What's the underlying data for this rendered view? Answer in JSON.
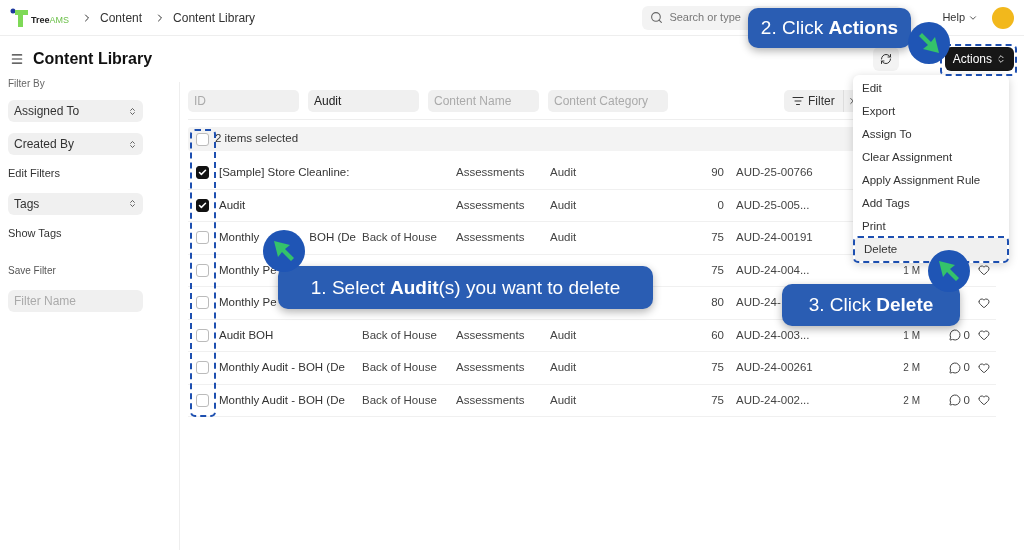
{
  "header": {
    "logo_start": "Tree",
    "logo_end": "AMS",
    "breadcrumbs": [
      "Content",
      "Content Library"
    ],
    "search_placeholder": "Search or type",
    "help": "Help"
  },
  "page": {
    "title": "Content Library",
    "actions_button": "Actions"
  },
  "sidebar": {
    "heading": "Filter By",
    "items": [
      {
        "kind": "select",
        "label": "Assigned To"
      },
      {
        "kind": "select",
        "label": "Created By"
      },
      {
        "kind": "link",
        "label": "Edit Filters"
      },
      {
        "kind": "select",
        "label": "Tags"
      },
      {
        "kind": "link",
        "label": "Show Tags"
      },
      {
        "kind": "heading",
        "label": "Save Filter"
      },
      {
        "kind": "input",
        "placeholder": "Filter Name"
      }
    ]
  },
  "filters": [
    {
      "placeholder": "ID"
    },
    {
      "value": "Audit"
    },
    {
      "placeholder": "Content Name"
    },
    {
      "placeholder": "Content Category"
    }
  ],
  "filter_button": "Filter",
  "table": {
    "select_all_checked": false,
    "selection_text": "2 items selected",
    "rows": [
      {
        "checked": true,
        "name": "[Sample] Store Cleanline:",
        "type": "Assessments",
        "category": "Audit",
        "score": "90",
        "id": "AUD-25-00766"
      },
      {
        "checked": true,
        "name": "Audit",
        "type": "Assessments",
        "category": "Audit",
        "score": "0",
        "id": "AUD-25-005..."
      },
      {
        "checked": false,
        "name": "Monthly",
        "name_rest": "BOH (De",
        "sub": "Back of House",
        "type": "Assessments",
        "category": "Audit",
        "score": "75",
        "id": "AUD-24-00191"
      },
      {
        "checked": false,
        "name": "Monthly Pe",
        "score": "75",
        "id": "AUD-24-004...",
        "time": "1 M",
        "liked": false
      },
      {
        "checked": false,
        "name": "Monthly Pe",
        "score": "80",
        "id": "AUD-24-",
        "liked": false
      },
      {
        "checked": false,
        "name": "Audit BOH",
        "sub": "Back of House",
        "type": "Assessments",
        "category": "Audit",
        "score": "60",
        "id": "AUD-24-003...",
        "time": "1 M",
        "comments": "0",
        "liked": false
      },
      {
        "checked": false,
        "name": "Monthly Audit - BOH (De",
        "sub": "Back of House",
        "type": "Assessments",
        "category": "Audit",
        "score": "75",
        "id": "AUD-24-00261",
        "time": "2 M",
        "comments": "0",
        "liked": false
      },
      {
        "checked": false,
        "name": "Monthly Audit - BOH (De",
        "sub": "Back of House",
        "type": "Assessments",
        "category": "Audit",
        "score": "75",
        "id": "AUD-24-002...",
        "time": "2 M",
        "comments": "0",
        "liked": false
      }
    ]
  },
  "menu": {
    "items": [
      {
        "label": "Edit",
        "selected": false
      },
      {
        "label": "Export",
        "selected": false
      },
      {
        "label": "Assign To",
        "selected": false
      },
      {
        "label": "Clear Assignment",
        "selected": false
      },
      {
        "label": "Apply Assignment Rule",
        "selected": false
      },
      {
        "label": "Add Tags",
        "selected": false
      },
      {
        "label": "Print",
        "selected": false
      },
      {
        "label": "Delete",
        "selected": true
      }
    ]
  },
  "callouts": [
    "1. Select **Audit**(s) you want to delete",
    "2. Click **Actions**",
    "3. Click **Delete**"
  ]
}
